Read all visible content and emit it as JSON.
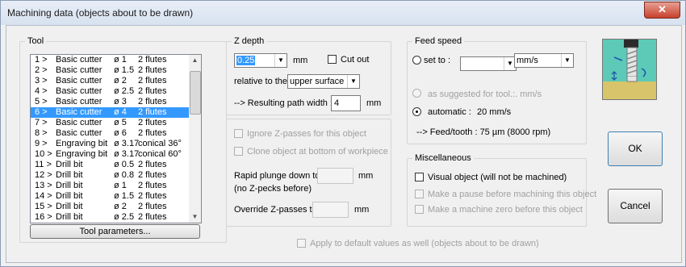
{
  "window": {
    "title": "Machining data (objects about to be drawn)",
    "close": "✕"
  },
  "tool": {
    "legend": "Tool",
    "items": [
      {
        "n": "1 >",
        "name": "Basic cutter",
        "dia": "ø 1",
        "flutes": "2 flutes"
      },
      {
        "n": "2 >",
        "name": "Basic cutter",
        "dia": "ø 1.5",
        "flutes": "2 flutes"
      },
      {
        "n": "3 >",
        "name": "Basic cutter",
        "dia": "ø 2",
        "flutes": "2 flutes"
      },
      {
        "n": "4 >",
        "name": "Basic cutter",
        "dia": "ø 2.5",
        "flutes": "2 flutes"
      },
      {
        "n": "5 >",
        "name": "Basic cutter",
        "dia": "ø 3",
        "flutes": "2 flutes"
      },
      {
        "n": "6 >",
        "name": "Basic cutter",
        "dia": "ø 4",
        "flutes": "2 flutes"
      },
      {
        "n": "7 >",
        "name": "Basic cutter",
        "dia": "ø 5",
        "flutes": "2 flutes"
      },
      {
        "n": "8 >",
        "name": "Basic cutter",
        "dia": "ø 6",
        "flutes": "2 flutes"
      },
      {
        "n": "9 >",
        "name": "Engraving bit",
        "dia": "ø 3.17",
        "flutes": "conical 36°"
      },
      {
        "n": "10 >",
        "name": "Engraving bit",
        "dia": "ø 3.17",
        "flutes": "conical 60°"
      },
      {
        "n": "11 >",
        "name": "Drill bit",
        "dia": "ø 0.5",
        "flutes": "2 flutes"
      },
      {
        "n": "12 >",
        "name": "Drill bit",
        "dia": "ø 0.8",
        "flutes": "2 flutes"
      },
      {
        "n": "13 >",
        "name": "Drill bit",
        "dia": "ø 1",
        "flutes": "2 flutes"
      },
      {
        "n": "14 >",
        "name": "Drill bit",
        "dia": "ø 1.5",
        "flutes": "2 flutes"
      },
      {
        "n": "15 >",
        "name": "Drill bit",
        "dia": "ø 2",
        "flutes": "2 flutes"
      },
      {
        "n": "16 >",
        "name": "Drill bit",
        "dia": "ø 2.5",
        "flutes": "2 flutes"
      }
    ],
    "selected_index": 5,
    "params_button": "Tool parameters..."
  },
  "zdepth": {
    "legend": "Z depth",
    "value": "0.25",
    "unit": "mm",
    "cut_out": "Cut out",
    "relative_label": "relative to the",
    "relative_value": "upper surface",
    "path_width_label": "--> Resulting path width :",
    "path_width_value": "4",
    "path_width_unit": "mm"
  },
  "options": {
    "ignore": "Ignore Z-passes for this object",
    "clone": "Clone object at bottom of workpiece",
    "rapid1": "Rapid plunge down to",
    "rapid2": "(no Z-pecks before)",
    "rapid_unit": "mm",
    "override": "Override Z-passes to",
    "override_unit": "mm"
  },
  "feed": {
    "legend": "Feed speed",
    "set_to": "set to :",
    "unit": "mm/s",
    "suggested": "as suggested for tool :",
    "suggested_value": "... mm/s",
    "automatic": "automatic :",
    "automatic_value": "20 mm/s",
    "feed_tooth": "--> Feed/tooth :  75 µm  (8000 rpm)"
  },
  "misc": {
    "legend": "Miscellaneous",
    "visual": "Visual object  (will not be machined)",
    "pause": "Make a pause before machining this object",
    "zero": "Make a machine zero before this object"
  },
  "buttons": {
    "ok": "OK",
    "cancel": "Cancel"
  },
  "footer": {
    "apply": "Apply to default values as well  (objects about to be drawn)"
  }
}
